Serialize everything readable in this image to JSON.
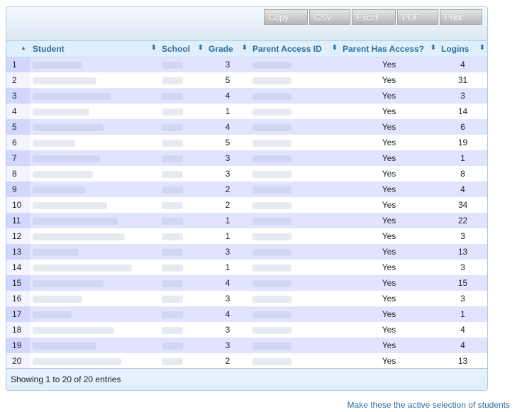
{
  "toolbar": {
    "buttons": [
      "Copy",
      "CSV",
      "Excel",
      "PDF",
      "Print"
    ]
  },
  "table": {
    "columns": [
      "",
      "Student",
      "School",
      "Grade",
      "Parent Access ID",
      "Parent Has Access?",
      "Logins"
    ],
    "rows": [
      {
        "n": "1",
        "grade": "3",
        "access": "Yes",
        "logins": "4"
      },
      {
        "n": "2",
        "grade": "5",
        "access": "Yes",
        "logins": "31"
      },
      {
        "n": "3",
        "grade": "4",
        "access": "Yes",
        "logins": "3"
      },
      {
        "n": "4",
        "grade": "1",
        "access": "Yes",
        "logins": "14"
      },
      {
        "n": "5",
        "grade": "4",
        "access": "Yes",
        "logins": "6"
      },
      {
        "n": "6",
        "grade": "5",
        "access": "Yes",
        "logins": "19"
      },
      {
        "n": "7",
        "grade": "3",
        "access": "Yes",
        "logins": "1"
      },
      {
        "n": "8",
        "grade": "3",
        "access": "Yes",
        "logins": "8"
      },
      {
        "n": "9",
        "grade": "2",
        "access": "Yes",
        "logins": "4"
      },
      {
        "n": "10",
        "grade": "2",
        "access": "Yes",
        "logins": "34"
      },
      {
        "n": "11",
        "grade": "1",
        "access": "Yes",
        "logins": "22"
      },
      {
        "n": "12",
        "grade": "1",
        "access": "Yes",
        "logins": "3"
      },
      {
        "n": "13",
        "grade": "3",
        "access": "Yes",
        "logins": "13"
      },
      {
        "n": "14",
        "grade": "1",
        "access": "Yes",
        "logins": "3"
      },
      {
        "n": "15",
        "grade": "4",
        "access": "Yes",
        "logins": "15"
      },
      {
        "n": "16",
        "grade": "3",
        "access": "Yes",
        "logins": "3"
      },
      {
        "n": "17",
        "grade": "4",
        "access": "Yes",
        "logins": "1"
      },
      {
        "n": "18",
        "grade": "3",
        "access": "Yes",
        "logins": "4"
      },
      {
        "n": "19",
        "grade": "3",
        "access": "Yes",
        "logins": "4"
      },
      {
        "n": "20",
        "grade": "2",
        "access": "Yes",
        "logins": "13"
      }
    ]
  },
  "footer": {
    "info": "Showing 1 to 20 of 20 entries"
  },
  "link": {
    "text": "Make these the active selection of students"
  }
}
